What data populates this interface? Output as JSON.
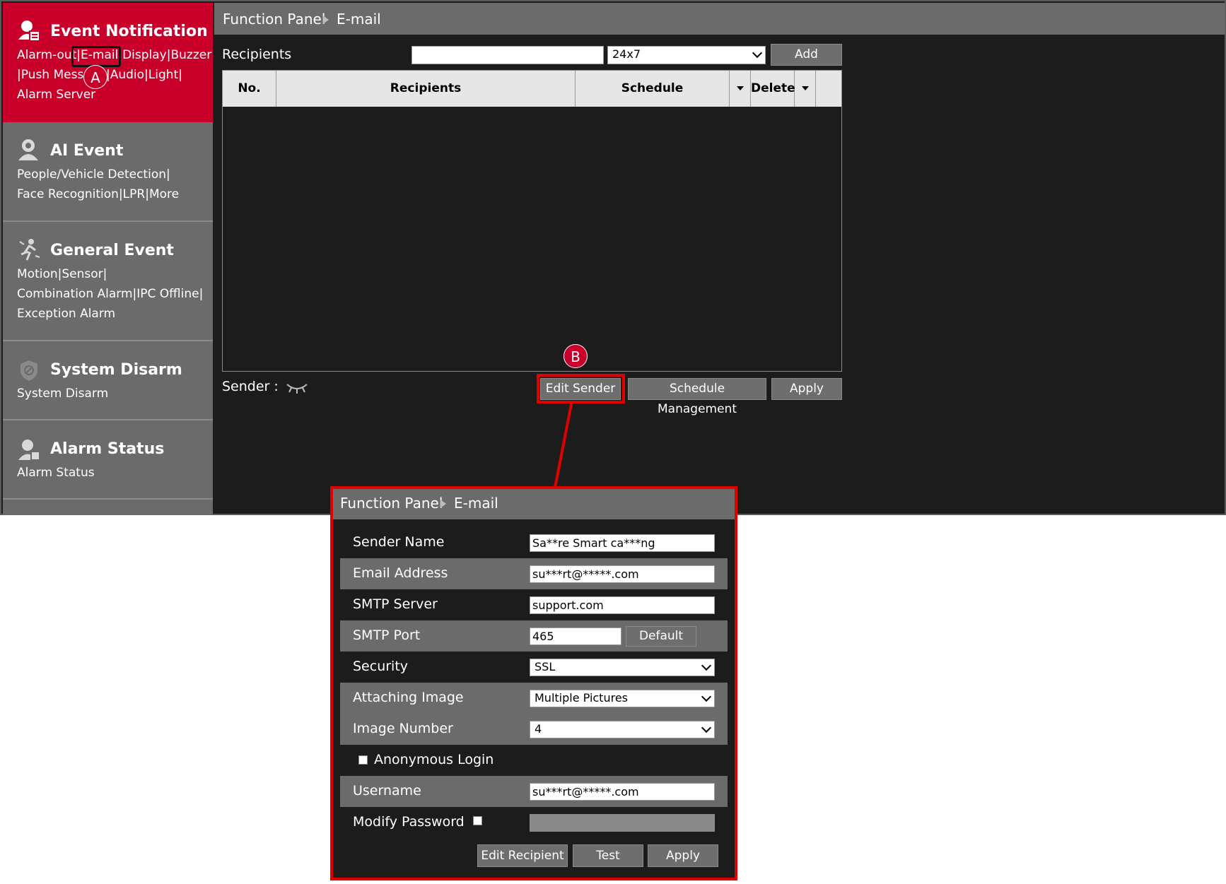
{
  "sidebar": {
    "sections": [
      {
        "title": "Event Notification",
        "links": [
          "Alarm-out|",
          "E-mail|",
          "Display|Buzzer",
          "|Push Message|Audio|Light|",
          "Alarm Server"
        ]
      },
      {
        "title": "AI Event",
        "links": [
          "People/Vehicle Detection|",
          "Face Recognition|LPR|More"
        ]
      },
      {
        "title": "General Event",
        "links": [
          "Motion|Sensor|",
          "Combination Alarm|IPC Offline|",
          "Exception Alarm"
        ]
      },
      {
        "title": "System Disarm",
        "links": [
          "System Disarm"
        ]
      },
      {
        "title": "Alarm Status",
        "links": [
          "Alarm Status"
        ]
      }
    ]
  },
  "header": {
    "crumb_root": "Function Panel",
    "crumb_page": "E-mail"
  },
  "recipients": {
    "label": "Recipients",
    "input_value": "",
    "schedule_value": "24x7",
    "add_label": "Add",
    "columns": {
      "no": "No.",
      "recipients": "Recipients",
      "schedule": "Schedule",
      "delete": "Delete"
    }
  },
  "sender": {
    "label": "Sender :",
    "edit_sender": "Edit Sender",
    "schedule_management": "Schedule Management",
    "apply": "Apply"
  },
  "markers": {
    "a": "A",
    "b": "B"
  },
  "dialog": {
    "crumb_root": "Function Panel",
    "crumb_page": "E-mail",
    "sender_name_label": "Sender Name",
    "sender_name_value": "Sa**re Smart ca***ng",
    "email_label": "Email Address",
    "email_value": "su***rt@*****.com",
    "smtp_server_label": "SMTP Server",
    "smtp_server_value": "support.com",
    "smtp_port_label": "SMTP Port",
    "smtp_port_value": "465",
    "default_label": "Default",
    "security_label": "Security",
    "security_value": "SSL",
    "attaching_label": "Attaching Image",
    "attaching_value": "Multiple Pictures",
    "image_number_label": "Image Number",
    "image_number_value": "4",
    "anonymous_label": "Anonymous Login",
    "username_label": "Username",
    "username_value": "su***rt@*****.com",
    "modify_password_label": "Modify Password",
    "edit_recipient": "Edit Recipient",
    "test": "Test",
    "apply": "Apply"
  },
  "colors": {
    "accent_red": "#c8002a",
    "highlight": "#e00000",
    "panel_gray": "#6b6b6b",
    "dark_bg": "#1c1c1c"
  }
}
